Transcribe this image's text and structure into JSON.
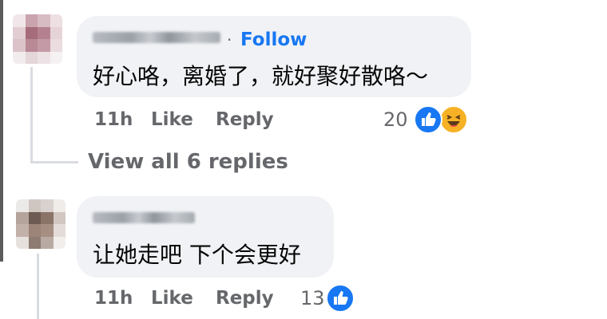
{
  "comments": [
    {
      "follow_label": "Follow",
      "separator": "·",
      "text": "好心咯，离婚了，就好聚好散咯～",
      "time": "11h",
      "like_label": "Like",
      "reply_label": "Reply",
      "reaction_count": "20",
      "reactions": [
        "like-icon",
        "haha-icon"
      ]
    },
    {
      "text": "让她走吧 下个会更好",
      "time": "11h",
      "like_label": "Like",
      "reply_label": "Reply",
      "reaction_count": "13",
      "reactions": [
        "like-icon"
      ]
    }
  ],
  "view_replies_label": "View all 6 replies",
  "colors": {
    "bubble": "#f0f2f5",
    "follow": "#1877f2",
    "meta": "#65676b",
    "text": "#050505",
    "haha": "#f7b125"
  }
}
